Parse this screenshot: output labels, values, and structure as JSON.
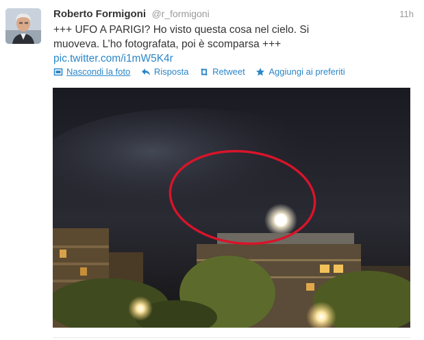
{
  "tweet": {
    "fullname": "Roberto Formigoni",
    "screen_name": "@r_formigoni",
    "timestamp": "11h",
    "text_line1": "+++ UFO A PARIGI? Ho visto questa cosa nel cielo. Si",
    "text_line2": "muoveva. L’ho fotografata, poi è scomparsa +++",
    "link": "pic.twitter.com/i1mW5K4r"
  },
  "actions": [
    {
      "label": "Nascondi la foto",
      "icon": "photo-icon"
    },
    {
      "label": "Risposta",
      "icon": "reply-icon"
    },
    {
      "label": "Retweet",
      "icon": "retweet-icon"
    },
    {
      "label": "Aggiungi ai preferiti",
      "icon": "star-icon"
    }
  ],
  "colors": {
    "link": "#2a86c9",
    "muted": "#999999",
    "text": "#333333",
    "highlight_ring": "#d8142a"
  }
}
